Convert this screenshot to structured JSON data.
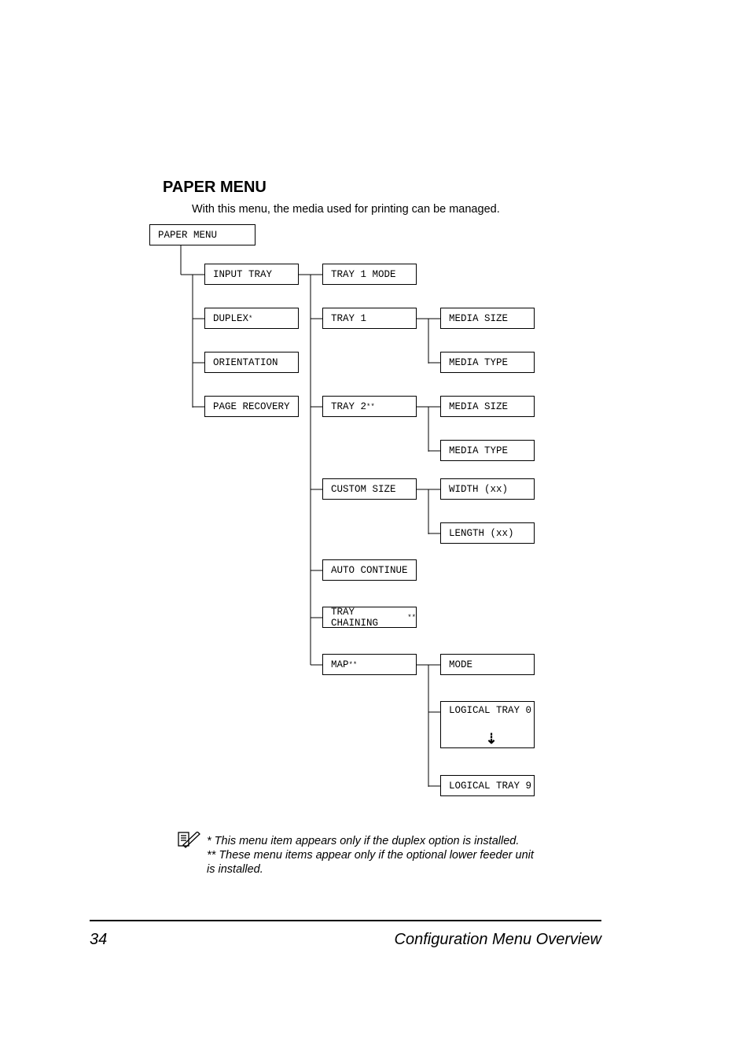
{
  "heading": "PAPER MENU",
  "intro": "With this menu, the media used for printing can be managed.",
  "boxes": {
    "root": "PAPER MENU",
    "col1": {
      "input_tray": "INPUT TRAY",
      "duplex": "DUPLEX",
      "duplex_sup": "*",
      "orientation": "ORIENTATION",
      "page_recovery": "PAGE RECOVERY"
    },
    "col2": {
      "tray1_mode": "TRAY 1 MODE",
      "tray1": "TRAY 1",
      "tray2": "TRAY 2",
      "tray2_sup": "**",
      "custom_size": "CUSTOM SIZE",
      "auto_continue": "AUTO CONTINUE",
      "tray_chaining": "TRAY CHAINING",
      "tray_chaining_sup": "**",
      "map": "MAP",
      "map_sup": "**"
    },
    "col3": {
      "media_size_a": "MEDIA SIZE",
      "media_type_a": "MEDIA TYPE",
      "media_size_b": "MEDIA SIZE",
      "media_type_b": "MEDIA TYPE",
      "width": "WIDTH (xx)",
      "length": "LENGTH (xx)",
      "mode": "MODE",
      "logical_tray_0": "LOGICAL TRAY 0",
      "logical_tray_9": "LOGICAL TRAY 9"
    }
  },
  "note_line1": "* This menu item appears only if the duplex option is installed.",
  "note_line2": "** These menu items appear only if the optional lower feeder unit is installed.",
  "footer": {
    "page": "34",
    "title": "Configuration Menu Overview"
  }
}
